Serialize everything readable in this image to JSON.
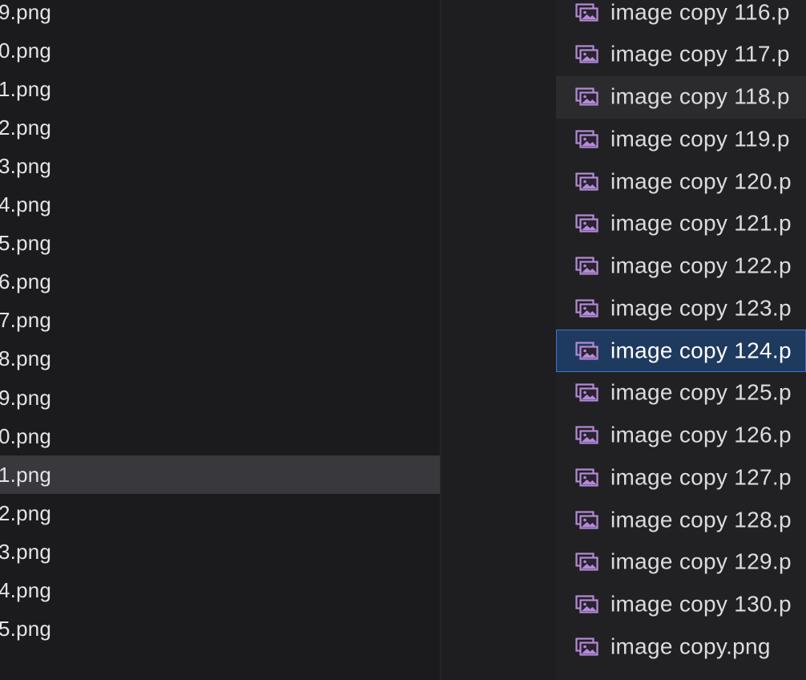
{
  "left_list": {
    "items": [
      {
        "label": "9.png"
      },
      {
        "label": "0.png"
      },
      {
        "label": "1.png"
      },
      {
        "label": "2.png"
      },
      {
        "label": "3.png"
      },
      {
        "label": "4.png"
      },
      {
        "label": "5.png"
      },
      {
        "label": "6.png"
      },
      {
        "label": "7.png"
      },
      {
        "label": "8.png"
      },
      {
        "label": "9.png"
      },
      {
        "label": "0.png"
      },
      {
        "label": "1.png",
        "selected": true
      },
      {
        "label": "2.png"
      },
      {
        "label": "3.png"
      },
      {
        "label": "4.png"
      },
      {
        "label": "5.png"
      }
    ]
  },
  "right_list": {
    "icon": "image-file-icon",
    "items": [
      {
        "label": "image copy 116.p"
      },
      {
        "label": "image copy 117.p"
      },
      {
        "label": "image copy 118.p",
        "hovered": true
      },
      {
        "label": "image copy 119.p"
      },
      {
        "label": "image copy 120.p"
      },
      {
        "label": "image copy 121.p"
      },
      {
        "label": "image copy 122.p"
      },
      {
        "label": "image copy 123.p"
      },
      {
        "label": "image copy 124.p",
        "selected": true
      },
      {
        "label": "image copy 125.p"
      },
      {
        "label": "image copy 126.p"
      },
      {
        "label": "image copy 127.p"
      },
      {
        "label": "image copy 128.p"
      },
      {
        "label": "image copy 129.p"
      },
      {
        "label": "image copy 130.p"
      },
      {
        "label": "image copy.png"
      }
    ]
  },
  "colors": {
    "selection_active": "#1f3a5f",
    "selection_active_border": "#3a78c9",
    "selection_inactive": "#38383d",
    "icon_accent": "#b48ad8"
  }
}
